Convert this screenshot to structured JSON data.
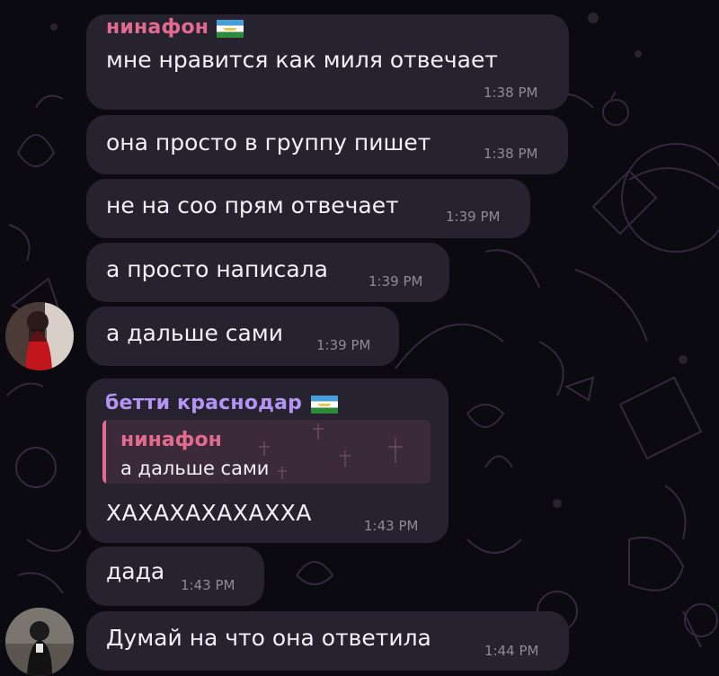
{
  "colors": {
    "background": "#0b0a10",
    "bubble": "#262230",
    "sender_pink": "#e26b8f",
    "sender_purple": "#b394f2",
    "reply_bar": "#e26b8f",
    "reply_bg": "#3a2a3a"
  },
  "messages": [
    {
      "sender": "нинафон",
      "text": "мне нравится как миля отвечает",
      "time": "1:38 PM"
    },
    {
      "text": "она просто в группу пишет",
      "time": "1:38 PM"
    },
    {
      "text": "не на соо прям отвечает",
      "time": "1:39 PM"
    },
    {
      "text": "а просто написала",
      "time": "1:39 PM"
    },
    {
      "text": "а дальше сами",
      "time": "1:39 PM"
    },
    {
      "sender": "бетти краснодар",
      "reply_sender": "нинафон",
      "reply_text": "а дальше сами",
      "text": "ХАХАХАХАХАХХА",
      "time": "1:43 PM"
    },
    {
      "text": "дада",
      "time": "1:43 PM"
    },
    {
      "text": "Думай на что она ответила",
      "time": "1:44 PM"
    }
  ],
  "icons": [
    "flag-icon",
    "avatar-user-1",
    "avatar-user-2"
  ]
}
